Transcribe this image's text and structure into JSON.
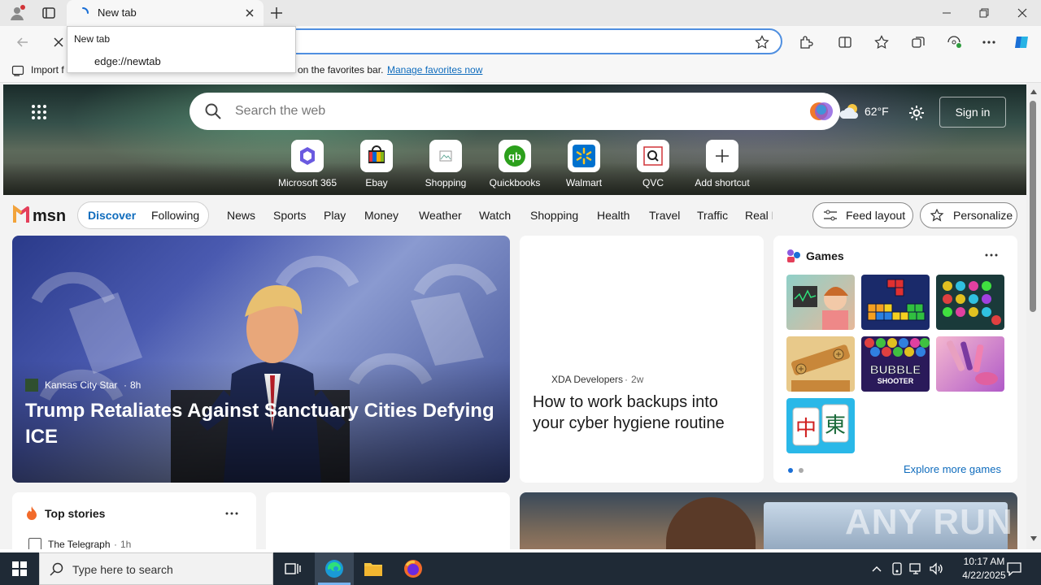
{
  "browser": {
    "tab_title": "New tab",
    "dropdown": {
      "title": "New tab",
      "url": "edge://newtab"
    },
    "favbar": {
      "import_label": "Import f",
      "message": "on the favorites bar.",
      "manage_link": "Manage favorites now"
    }
  },
  "hero": {
    "search_placeholder": "Search the web",
    "weather": "62°F",
    "signin_label": "Sign in",
    "shortcuts": [
      {
        "label": "Microsoft 365",
        "icon": "microsoft365-icon"
      },
      {
        "label": "Ebay",
        "icon": "ebay-icon"
      },
      {
        "label": "Shopping",
        "icon": "shopping-icon"
      },
      {
        "label": "Quickbooks",
        "icon": "quickbooks-icon"
      },
      {
        "label": "Walmart",
        "icon": "walmart-icon"
      },
      {
        "label": "QVC",
        "icon": "qvc-icon"
      },
      {
        "label": "Add shortcut",
        "icon": "plus-icon"
      }
    ]
  },
  "nav": {
    "logo": "msn",
    "discover": "Discover",
    "following": "Following",
    "items": [
      "News",
      "Sports",
      "Play",
      "Money",
      "Weather",
      "Watch",
      "Shopping",
      "Health",
      "Travel",
      "Traffic",
      "Real E"
    ],
    "feed_layout": "Feed layout",
    "personalize": "Personalize"
  },
  "main_story": {
    "source": "Kansas City Star",
    "time": "8h",
    "headline": "Trump Retaliates Against Sanctuary Cities Defying ICE"
  },
  "xda_story": {
    "source": "XDA Developers",
    "time": "2w",
    "headline": "How to work backups into your cyber hygiene routine"
  },
  "games": {
    "title": "Games",
    "explore": "Explore more games",
    "bubble_text": "BUBBLE",
    "bubble_sub": "SHOOTER",
    "mahjong_chars": "中東"
  },
  "top_stories": {
    "title": "Top stories",
    "source": "The Telegraph",
    "time": "1h"
  },
  "watermark": "ANY RUN",
  "taskbar": {
    "search_placeholder": "Type here to search",
    "time": "10:17 AM",
    "date": "4/22/2025"
  },
  "colors": {
    "accent": "#0f6cbd",
    "address_border": "#4f8fe0",
    "taskbar": "#1f2a36"
  }
}
